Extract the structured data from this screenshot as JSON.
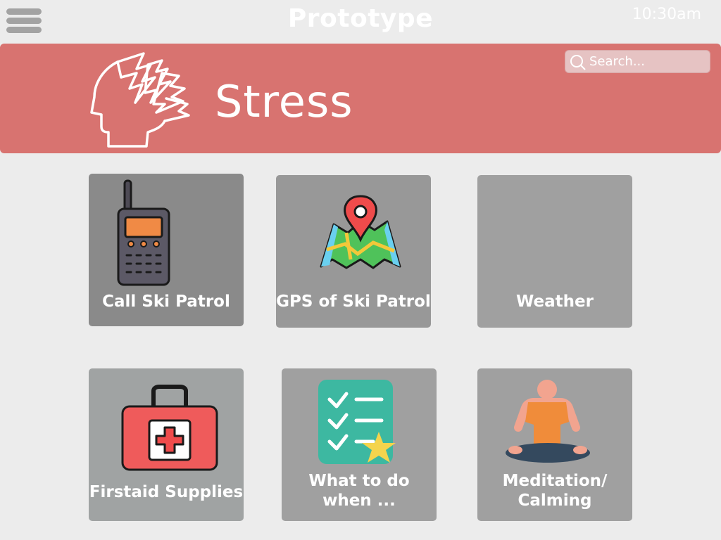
{
  "topbar": {
    "title": "Prototype",
    "time": "10:30am",
    "menu_icon": "hamburger-menu-icon"
  },
  "banner": {
    "title": "Stress",
    "icon": "stressed-head-icon",
    "search": {
      "placeholder": "Search...",
      "value": ""
    }
  },
  "tiles": [
    {
      "label": "Call Ski Patrol",
      "icon": "walkie-talkie-icon"
    },
    {
      "label": "GPS of Ski Patrol",
      "icon": "map-pin-icon"
    },
    {
      "label": "Weather",
      "icon": ""
    },
    {
      "label": "Firstaid Supplies",
      "icon": "first-aid-kit-icon"
    },
    {
      "label": "What to do\nwhen ...",
      "icon": "checklist-icon"
    },
    {
      "label": "Meditation/\nCalming",
      "icon": "meditation-icon"
    }
  ],
  "colors": {
    "background": "#ececec",
    "banner": "#d87370",
    "tile": "#a0a0a0",
    "text": "#ffffff"
  }
}
